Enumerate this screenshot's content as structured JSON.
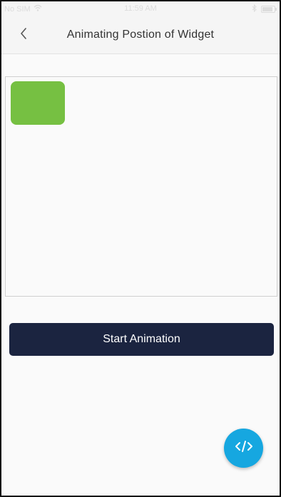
{
  "status_bar": {
    "carrier": "No SIM",
    "time": "11:59 AM",
    "wifi_icon": "wifi-icon",
    "bluetooth_icon": "bluetooth-icon",
    "battery_icon": "battery-icon"
  },
  "nav": {
    "title": "Animating Postion of Widget",
    "back_icon": "chevron-left-icon"
  },
  "stage": {
    "box_color": "#76c042"
  },
  "actions": {
    "start_label": "Start Animation",
    "start_color": "#1b2440"
  },
  "fab": {
    "icon": "code-icon",
    "color": "#16a7e0"
  }
}
